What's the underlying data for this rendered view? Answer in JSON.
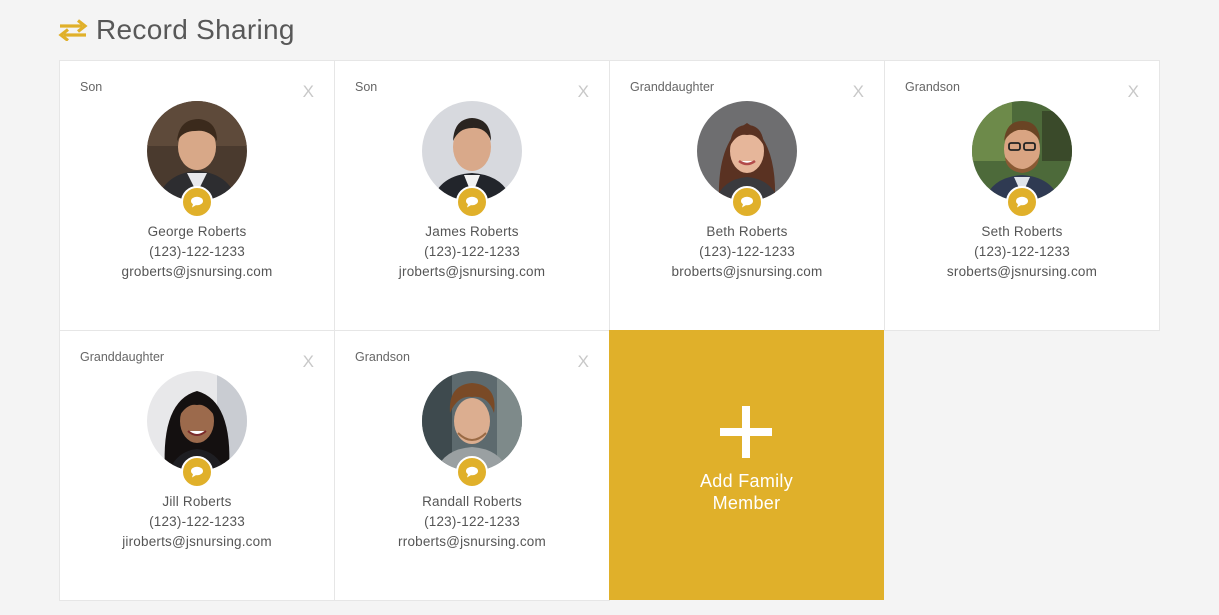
{
  "header": {
    "title": "Record Sharing",
    "icon": "swap-arrows-icon",
    "accent_color": "#e0b02a"
  },
  "members": [
    {
      "relation": "Son",
      "name": "George Roberts",
      "phone": "(123)-122-1233",
      "email": "groberts@jsnursing.com",
      "close_label": "X"
    },
    {
      "relation": "Son",
      "name": "James Roberts",
      "phone": "(123)-122-1233",
      "email": "jroberts@jsnursing.com",
      "close_label": "X"
    },
    {
      "relation": "Granddaughter",
      "name": "Beth Roberts",
      "phone": "(123)-122-1233",
      "email": "broberts@jsnursing.com",
      "close_label": "X"
    },
    {
      "relation": "Grandson",
      "name": "Seth Roberts",
      "phone": "(123)-122-1233",
      "email": "sroberts@jsnursing.com",
      "close_label": "X"
    },
    {
      "relation": "Granddaughter",
      "name": "Jill Roberts",
      "phone": "(123)-122-1233",
      "email": "jiroberts@jsnursing.com",
      "close_label": "X"
    },
    {
      "relation": "Grandson",
      "name": "Randall Roberts",
      "phone": "(123)-122-1233",
      "email": "rroberts@jsnursing.com",
      "close_label": "X"
    }
  ],
  "add_member": {
    "label_line1": "Add Family",
    "label_line2": "Member",
    "icon": "plus-icon"
  }
}
